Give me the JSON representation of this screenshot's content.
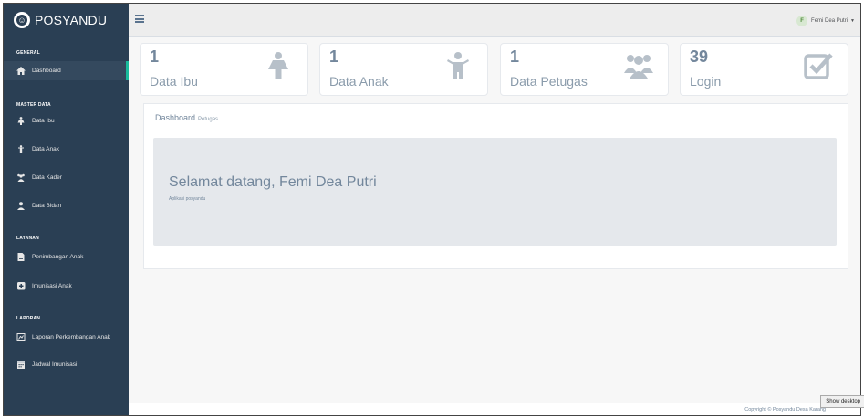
{
  "brand": {
    "name": "POSYANDU"
  },
  "sidebar": {
    "sections": [
      {
        "title": "GENERAL"
      },
      {
        "title": "MASTER DATA"
      },
      {
        "title": "LAYANAN"
      },
      {
        "title": "LAPORAN"
      }
    ],
    "items": [
      {
        "label": "Dashboard",
        "icon": "home-icon"
      },
      {
        "label": "Data Ibu",
        "icon": "female-icon"
      },
      {
        "label": "Data Anak",
        "icon": "child-icon"
      },
      {
        "label": "Data Kader",
        "icon": "users-icon"
      },
      {
        "label": "Data Bidan",
        "icon": "user-icon"
      },
      {
        "label": "Penimbangan Anak",
        "icon": "file-icon"
      },
      {
        "label": "Imunisasi Anak",
        "icon": "plus-square-icon"
      },
      {
        "label": "Laporan Perkembangan Anak",
        "icon": "report-icon"
      },
      {
        "label": "Jadwal Imunisasi",
        "icon": "calendar-icon"
      }
    ]
  },
  "topbar": {
    "user_name": "Femi Dea Putri",
    "avatar_initial": "F"
  },
  "tiles": [
    {
      "count": "1",
      "label": "Data Ibu",
      "icon": "female-icon"
    },
    {
      "count": "1",
      "label": "Data Anak",
      "icon": "child-icon"
    },
    {
      "count": "1",
      "label": "Data Petugas",
      "icon": "users-icon"
    },
    {
      "count": "39",
      "label": "Login",
      "icon": "check-square-icon"
    }
  ],
  "panel": {
    "title": "Dashboard",
    "subtitle": "Petugas",
    "welcome": "Selamat datang, Femi Dea Putri",
    "app_desc": "Aplikasi posyandu"
  },
  "footer": {
    "copyright": "Copyright © Posyandu Desa Karang"
  },
  "tooltip": {
    "text": "Show desktop"
  },
  "colors": {
    "sidebar": "#2a3f54",
    "accent": "#1abb9c",
    "muted": "#73879c"
  }
}
